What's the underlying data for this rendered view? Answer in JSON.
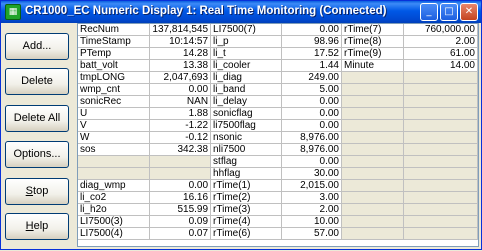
{
  "window": {
    "title": "CR1000_EC Numeric Display 1: Real Time Monitoring (Connected)",
    "icon": "numeric-display-app-icon",
    "controls": [
      "minimize-icon",
      "maximize-icon",
      "close-icon"
    ]
  },
  "buttons": {
    "add": "Add...",
    "delete": "Delete",
    "delete_all": "Delete All",
    "options": "Options...",
    "stop_prefix": "S",
    "stop_rest": "top",
    "help_prefix": "H",
    "help_rest": "elp"
  },
  "grid": {
    "rows": [
      [
        [
          "RecNum",
          "137,814,545"
        ],
        [
          "LI7500(7)",
          "0.00"
        ],
        [
          "rTime(7)",
          "760,000.00"
        ]
      ],
      [
        [
          "TimeStamp",
          "10:14:57"
        ],
        [
          "li_p",
          "98.96"
        ],
        [
          "rTime(8)",
          "2.00"
        ]
      ],
      [
        [
          "PTemp",
          "14.28"
        ],
        [
          "li_t",
          "17.52"
        ],
        [
          "rTime(9)",
          "61.00"
        ]
      ],
      [
        [
          "batt_volt",
          "13.38"
        ],
        [
          "li_cooler",
          "1.44"
        ],
        [
          "Minute",
          "14.00"
        ]
      ],
      [
        [
          "tmpLONG",
          "2,047,693"
        ],
        [
          "li_diag",
          "249.00"
        ],
        [
          "",
          ""
        ]
      ],
      [
        [
          "wmp_cnt",
          "0.00"
        ],
        [
          "li_band",
          "5.00"
        ],
        [
          "",
          ""
        ]
      ],
      [
        [
          "sonicRec",
          "NAN"
        ],
        [
          "li_delay",
          "0.00"
        ],
        [
          "",
          ""
        ]
      ],
      [
        [
          "U",
          "1.88"
        ],
        [
          "sonicflag",
          "0.00"
        ],
        [
          "",
          ""
        ]
      ],
      [
        [
          "V",
          "-1.22"
        ],
        [
          "li7500flag",
          "0.00"
        ],
        [
          "",
          ""
        ]
      ],
      [
        [
          "W",
          "-0.12"
        ],
        [
          "nsonic",
          "8,976.00"
        ],
        [
          "",
          ""
        ]
      ],
      [
        [
          "sos",
          "342.38"
        ],
        [
          "nli7500",
          "8,976.00"
        ],
        [
          "",
          ""
        ]
      ],
      [
        [
          "",
          ""
        ],
        [
          "stflag",
          "0.00"
        ],
        [
          "",
          ""
        ]
      ],
      [
        [
          "",
          ""
        ],
        [
          "hhflag",
          "30.00"
        ],
        [
          "",
          ""
        ]
      ],
      [
        [
          "diag_wmp",
          "0.00"
        ],
        [
          "rTime(1)",
          "2,015.00"
        ],
        [
          "",
          ""
        ]
      ],
      [
        [
          "li_co2",
          "16.16"
        ],
        [
          "rTime(2)",
          "3.00"
        ],
        [
          "",
          ""
        ]
      ],
      [
        [
          "li_h2o",
          "515.99"
        ],
        [
          "rTime(3)",
          "2.00"
        ],
        [
          "",
          ""
        ]
      ],
      [
        [
          "LI7500(3)",
          "0.09"
        ],
        [
          "rTime(4)",
          "10.00"
        ],
        [
          "",
          ""
        ]
      ],
      [
        [
          "LI7500(4)",
          "0.07"
        ],
        [
          "rTime(6)",
          "57.00"
        ],
        [
          "",
          ""
        ]
      ]
    ]
  }
}
